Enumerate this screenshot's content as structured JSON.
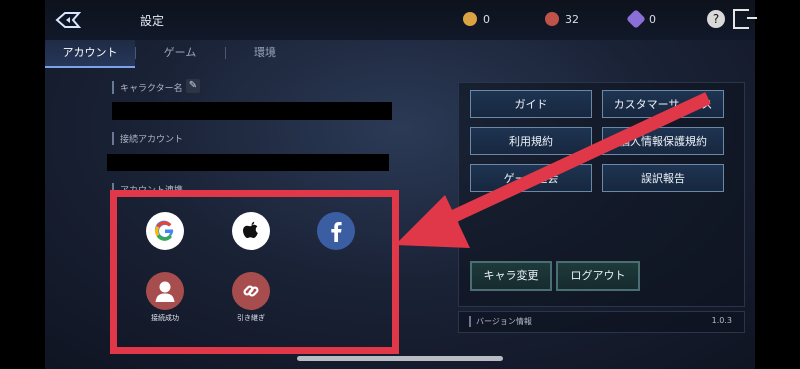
{
  "header": {
    "title": "設定",
    "currencies": [
      {
        "icon": "gold-coin-icon",
        "value": "0",
        "color": "#d9a441"
      },
      {
        "icon": "red-gem-icon",
        "value": "32",
        "color": "#c0524a"
      },
      {
        "icon": "purple-crystal-icon",
        "value": "0",
        "color": "#8a6fd6"
      }
    ],
    "help_label": "?"
  },
  "tabs": [
    "アカウント",
    "ゲーム",
    "環境"
  ],
  "account": {
    "character_label": "キャラクター名",
    "connected_label": "接続アカウント",
    "link_label": "アカウント連携",
    "sns": [
      {
        "name": "google-icon"
      },
      {
        "name": "apple-icon"
      },
      {
        "name": "facebook-icon"
      },
      {
        "name": "user-icon",
        "caption": "接続成功"
      },
      {
        "name": "link-icon",
        "caption": "引き継ぎ"
      }
    ]
  },
  "menu": {
    "buttons": [
      "ガイド",
      "カスタマーサービス",
      "利用規約",
      "個人情報保護規約",
      "ゲーム退会",
      "誤訳報告"
    ],
    "change_char": "キャラ変更",
    "logout": "ログアウト",
    "version_label": "バージョン情報",
    "version_value": "1.0.3"
  },
  "colors": {
    "highlight": "#e03848",
    "accent": "#7ea2e8"
  }
}
